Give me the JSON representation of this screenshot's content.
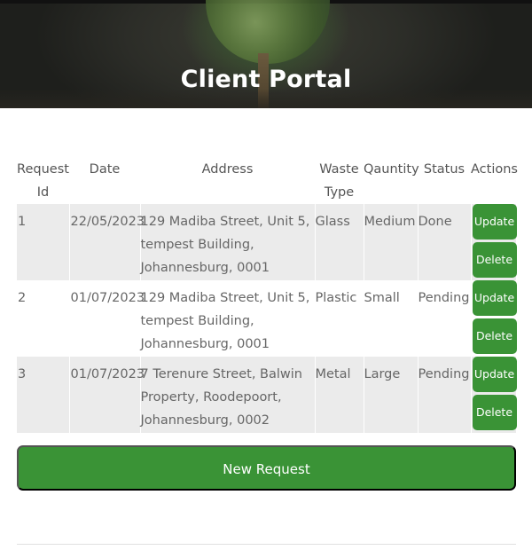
{
  "header": {
    "title": "Client Portal"
  },
  "table": {
    "columns": [
      "Request Id",
      "Date",
      "Address",
      "Waste Type",
      "Qauntity",
      "Status",
      "Actions"
    ],
    "rows": [
      {
        "id": "1",
        "date": "22/05/2023",
        "address": "129 Madiba Street, Unit 5, tempest Building, Johannesburg, 0001",
        "waste_type": "Glass",
        "quantity": "Medium",
        "status": "Done"
      },
      {
        "id": "2",
        "date": "01/07/2023",
        "address": "129 Madiba Street, Unit 5, tempest Building, Johannesburg, 0001",
        "waste_type": "Plastic",
        "quantity": "Small",
        "status": "Pending"
      },
      {
        "id": "3",
        "date": "01/07/2023",
        "address": "7 Terenure Street, Balwin Property, Roodepoort, Johannesburg, 0002",
        "waste_type": "Metal",
        "quantity": "Large",
        "status": "Pending"
      }
    ],
    "update_label": "Update",
    "delete_label": "Delete"
  },
  "actions": {
    "new_request_label": "New Request"
  },
  "colors": {
    "accent": "#3a9336",
    "row_stripe": "#ebebeb"
  }
}
